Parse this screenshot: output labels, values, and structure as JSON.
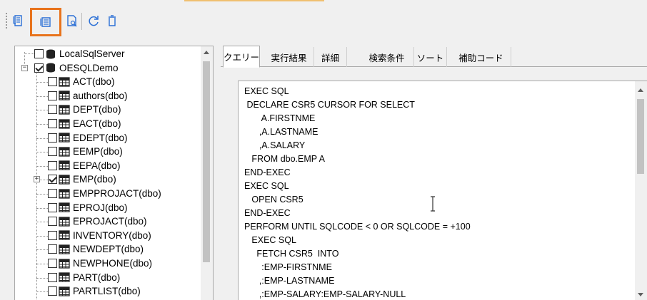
{
  "toolbar": {
    "buttons": [
      {
        "name": "generate-query",
        "icon": "sql-document-icon"
      },
      {
        "name": "generate-cursor-query",
        "icon": "cursor-document-icon",
        "selected": true
      },
      {
        "name": "search-query",
        "icon": "document-search-icon"
      },
      {
        "name": "refresh",
        "icon": "refresh-icon"
      },
      {
        "name": "clear",
        "icon": "trash-icon"
      }
    ],
    "accent_color": "#e8731c"
  },
  "tree": {
    "nodes": [
      {
        "label": "LocalSqlServer",
        "type": "database",
        "checked": false,
        "level": 0
      },
      {
        "label": "OESQLDemo",
        "type": "database",
        "checked": true,
        "level": 0,
        "expanded": true
      },
      {
        "label": "ACT(dbo)",
        "type": "table",
        "checked": false,
        "level": 1
      },
      {
        "label": "authors(dbo)",
        "type": "table",
        "checked": false,
        "level": 1
      },
      {
        "label": "DEPT(dbo)",
        "type": "table",
        "checked": false,
        "level": 1
      },
      {
        "label": "EACT(dbo)",
        "type": "table",
        "checked": false,
        "level": 1
      },
      {
        "label": "EDEPT(dbo)",
        "type": "table",
        "checked": false,
        "level": 1
      },
      {
        "label": "EEMP(dbo)",
        "type": "table",
        "checked": false,
        "level": 1
      },
      {
        "label": "EEPA(dbo)",
        "type": "table",
        "checked": false,
        "level": 1
      },
      {
        "label": "EMP(dbo)",
        "type": "table",
        "checked": true,
        "level": 1,
        "expandable": true
      },
      {
        "label": "EMPPROJACT(dbo)",
        "type": "table",
        "checked": false,
        "level": 1
      },
      {
        "label": "EPROJ(dbo)",
        "type": "table",
        "checked": false,
        "level": 1
      },
      {
        "label": "EPROJACT(dbo)",
        "type": "table",
        "checked": false,
        "level": 1
      },
      {
        "label": "INVENTORY(dbo)",
        "type": "table",
        "checked": false,
        "level": 1
      },
      {
        "label": "NEWDEPT(dbo)",
        "type": "table",
        "checked": false,
        "level": 1
      },
      {
        "label": "NEWPHONE(dbo)",
        "type": "table",
        "checked": false,
        "level": 1
      },
      {
        "label": "PART(dbo)",
        "type": "table",
        "checked": false,
        "level": 1
      },
      {
        "label": "PARTLIST(dbo)",
        "type": "table",
        "checked": false,
        "level": 1
      }
    ]
  },
  "tabs": [
    {
      "label": "クエリー",
      "active": true
    },
    {
      "label": "実行結果"
    },
    {
      "label": "詳細"
    },
    {
      "label": "検索条件"
    },
    {
      "label": "ソート"
    },
    {
      "label": "補助コード"
    }
  ],
  "editor": {
    "lines": [
      "EXEC SQL",
      " DECLARE CSR5 CURSOR FOR SELECT",
      "       A.FIRSTNME",
      "      ,A.LASTNAME",
      "      ,A.SALARY",
      "   FROM dbo.EMP A",
      "END-EXEC",
      "EXEC SQL",
      "   OPEN CSR5",
      "END-EXEC",
      "PERFORM UNTIL SQLCODE < 0 OR SQLCODE = +100",
      "   EXEC SQL",
      "     FETCH CSR5  INTO",
      "       :EMP-FIRSTNME",
      "      ,:EMP-LASTNAME",
      "      ,:EMP-SALARY:EMP-SALARY-NULL"
    ]
  }
}
